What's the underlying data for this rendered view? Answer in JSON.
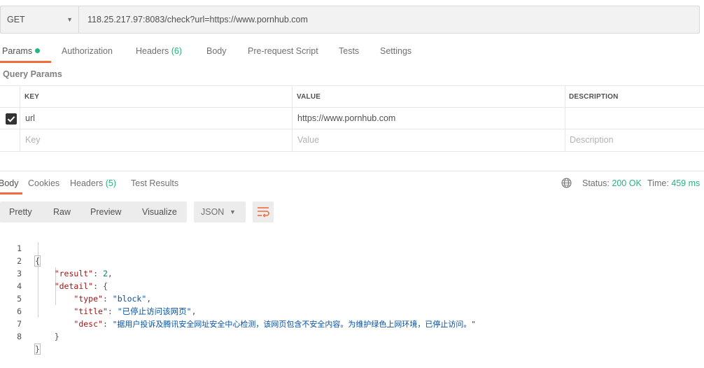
{
  "request": {
    "method": "GET",
    "url": "118.25.217.97:8083/check?url=https://www.pornhub.com"
  },
  "request_tabs": {
    "params": "Params",
    "authorization": "Authorization",
    "headers": "Headers",
    "headers_count": "(6)",
    "body": "Body",
    "pre_request": "Pre-request Script",
    "tests": "Tests",
    "settings": "Settings"
  },
  "query_params": {
    "title": "Query Params",
    "columns": {
      "key": "KEY",
      "value": "VALUE",
      "description": "DESCRIPTION"
    },
    "row": {
      "key": "url",
      "value": "https://www.pornhub.com",
      "checked": true
    },
    "placeholders": {
      "key": "Key",
      "value": "Value",
      "description": "Description"
    }
  },
  "response_tabs": {
    "body": "Body",
    "cookies": "Cookies",
    "headers": "Headers",
    "headers_count": "(5)",
    "test_results": "Test Results"
  },
  "response_status": {
    "status_label": "Status:",
    "status_value": "200 OK",
    "time_label": "Time:",
    "time_value": "459 ms"
  },
  "view_modes": {
    "pretty": "Pretty",
    "raw": "Raw",
    "preview": "Preview",
    "visualize": "Visualize",
    "format": "JSON"
  },
  "code": {
    "line_numbers": [
      "1",
      "2",
      "3",
      "4",
      "5",
      "6",
      "7",
      "8"
    ],
    "result_key": "\"result\"",
    "result_value": "2",
    "detail_key": "\"detail\"",
    "type_key": "\"type\"",
    "type_value": "\"block\"",
    "title_key": "\"title\"",
    "title_value": "\"已停止访问该网页\"",
    "desc_key": "\"desc\"",
    "desc_value": "\"据用户投诉及腾讯安全网址安全中心检测，该网页包含不安全内容。为维护绿色上网环境，已停止访问。\""
  },
  "colors": {
    "accent": "#f26b3a",
    "success": "#26b47f",
    "json_key": "#a31515",
    "json_string": "#0451a5",
    "json_number": "#098658"
  },
  "icons": {
    "method_dropdown": "chevron-down-icon",
    "globe": "globe-icon",
    "wrap": "wrap-lines-icon",
    "checkbox": "checkbox-checked-icon"
  }
}
